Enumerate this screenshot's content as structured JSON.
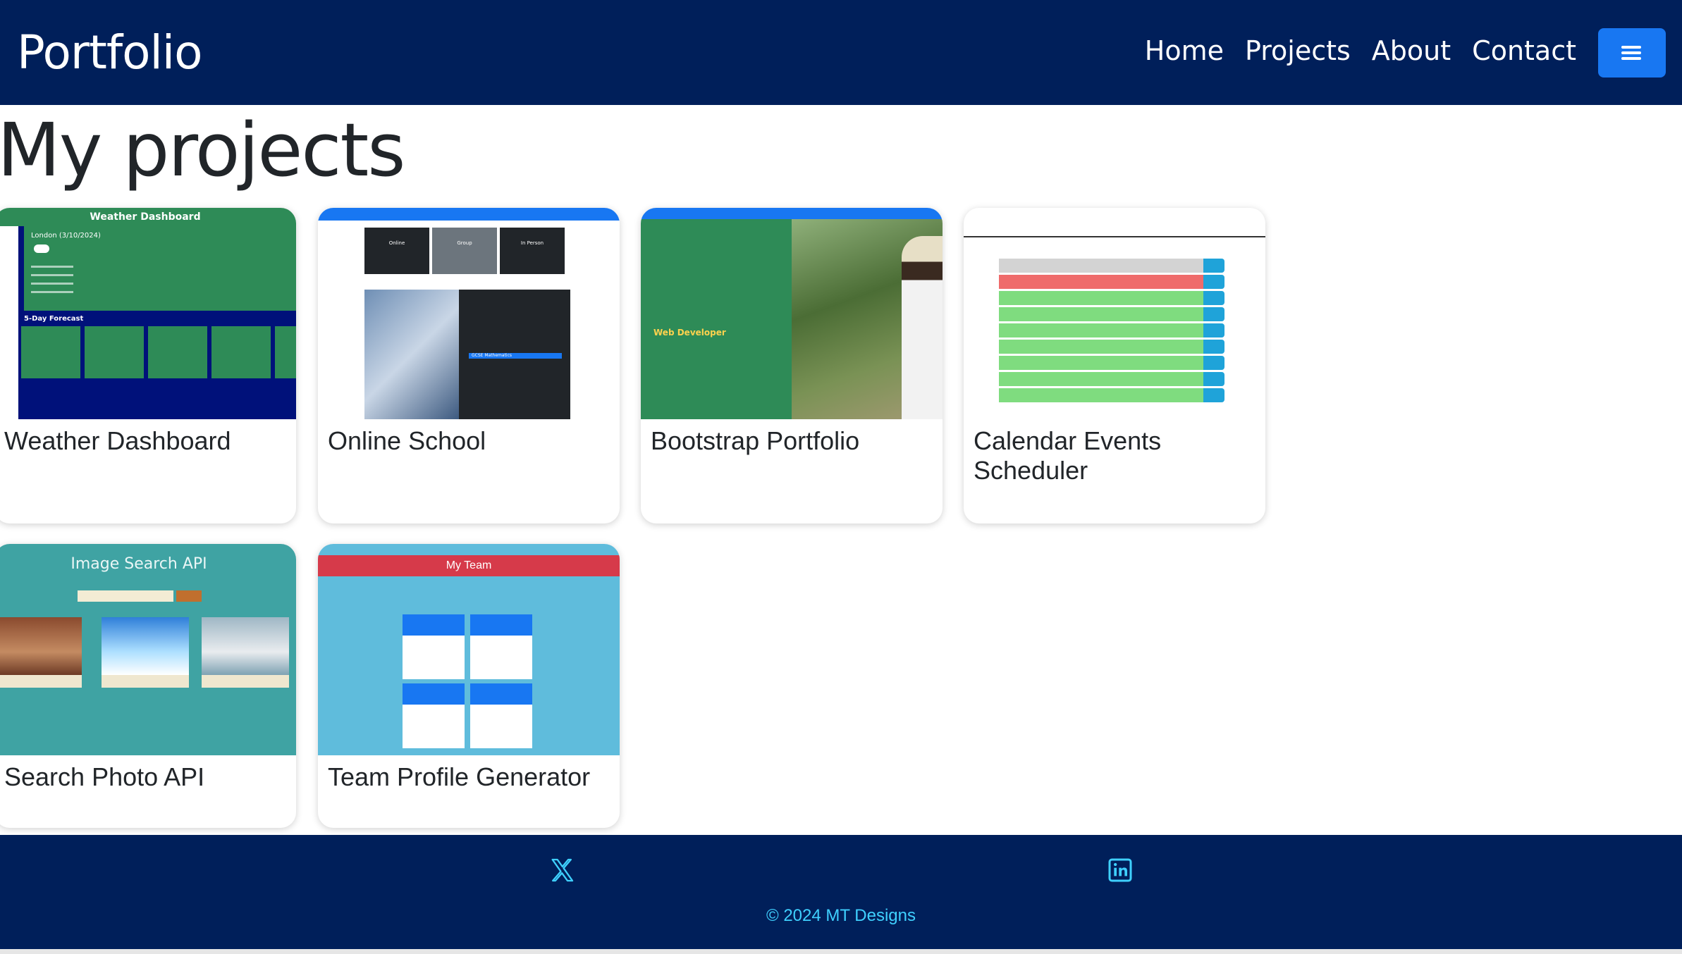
{
  "navbar": {
    "brand": "Portfolio",
    "links": [
      "Home",
      "Projects",
      "About",
      "Contact"
    ],
    "menu_icon": "hamburger-icon"
  },
  "main": {
    "title": "My projects",
    "projects": [
      {
        "title": "Weather Dashboard",
        "thumbnail": {
          "header": "Weather Dashboard",
          "city": "London (3/10/2024)",
          "forecast_label": "5-Day Forecast"
        }
      },
      {
        "title": "Online School",
        "thumbnail": {
          "boxes": [
            "Online",
            "Group",
            "In Person"
          ],
          "hero_label": "GCSE Mathematics"
        }
      },
      {
        "title": "Bootstrap Portfolio",
        "thumbnail": {
          "hero_label": "Web Developer"
        }
      },
      {
        "title": "Calendar Events Scheduler",
        "thumbnail": {}
      },
      {
        "title": "Search Photo API",
        "thumbnail": {
          "header": "Image Search API"
        }
      },
      {
        "title": "Team Profile Generator",
        "thumbnail": {
          "header": "My Team"
        }
      }
    ]
  },
  "footer": {
    "social": [
      "x-twitter-icon",
      "linkedin-icon"
    ],
    "copyright": "© 2024 MT Designs"
  },
  "colors": {
    "navbar": "#001f5a",
    "accent": "#1877f2",
    "footer_text": "#3fd0ff"
  }
}
